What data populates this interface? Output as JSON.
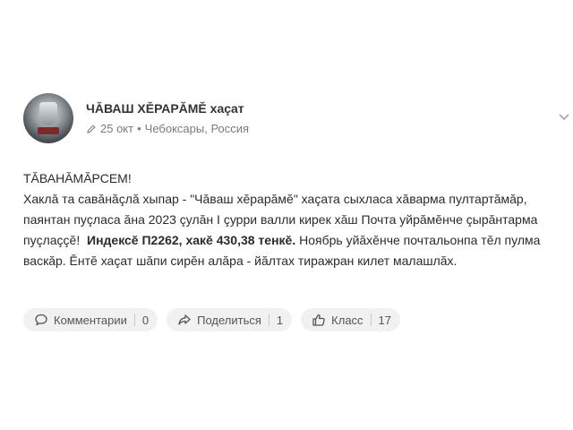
{
  "post": {
    "author": "ЧĂВАШ ХĔРАРĂМĔ хаçат",
    "date": "25 окт",
    "separator": "•",
    "location": "Чебоксары, Россия",
    "greeting": "ТĂВАНĂМĂРСЕМ!",
    "text_part1": "Хаклă та савăнăçлă хыпар - \"Чăваш хĕрарăмĕ\" хаçата сыхласа хăварма пултартăмăр, паянтан пуçласа ăна 2023 çулăн I çурри валли кирек хăш Почта уйрăмĕнче çырăнтарма пуçлаççĕ!",
    "text_bold": "Индексĕ П2262, хакĕ 430,38 тенкĕ.",
    "text_part2": "Ноябрь уйăхĕнче почтальонпа тĕл пулма васкăр. Ĕнтĕ хаçат шăпи сирĕн алăра - йăлтах тиражран килет малашлăх."
  },
  "actions": {
    "comments": {
      "label": "Комментарии",
      "count": "0",
      "icon": "comment-icon"
    },
    "share": {
      "label": "Поделиться",
      "count": "1",
      "icon": "share-icon"
    },
    "like": {
      "label": "Класс",
      "count": "17",
      "icon": "thumbs-up-icon"
    }
  },
  "icons": {
    "edit": "pencil-icon",
    "menu": "chevron-down-icon"
  },
  "colors": {
    "pill_background": "#f1f1f1",
    "meta_text": "#7b7b7b"
  }
}
